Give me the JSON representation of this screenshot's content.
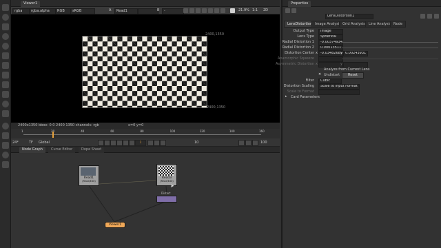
{
  "viewer": {
    "tab_label": "Viewer1",
    "controls": {
      "channels": "rgba",
      "layer": "rgba.alpha",
      "colorspace": "RGB",
      "lut": "sRGB",
      "input_a_label": "A",
      "input_a": "Read1",
      "input_b_label": "B",
      "input_b": "-",
      "zoom": "21.9%",
      "ratio": "1:1",
      "mode": "2D"
    },
    "image_corner_top": "2400,1350",
    "image_corner_bottom": "2400,1350",
    "info_left": "2400x1350  bbox: 0 0 2400 1350 channels: rgb",
    "info_coord": "x=0 y=0",
    "timeline_ticks": [
      "1",
      "20",
      "40",
      "60",
      "80",
      "100",
      "120",
      "140",
      "160"
    ],
    "playback": {
      "fps": "24*",
      "tf": "TF",
      "global": "Global",
      "frame": "1",
      "step": "10",
      "end_frame": "100"
    }
  },
  "node_tabs": [
    "Node Graph",
    "Curve Editor",
    "Dope Sheet"
  ],
  "nodes": {
    "read_left_label": "Read1",
    "read_left_sub": "(Read/Edit)",
    "read_right_label": "Read3",
    "read_right_sub": "(Read/Edit)",
    "distort_label": "Distort",
    "viewer_label": "Viewer1"
  },
  "properties": {
    "panel_title": "Properties",
    "node_name": "LensDistortion1",
    "tabs": [
      "LensDistortion",
      "Image Analysis",
      "Grid Analysis",
      "Line Analysis",
      "Node"
    ],
    "fields": {
      "output_type_label": "Output Type",
      "output_type": "Image",
      "lens_type_label": "Lens Type",
      "lens_type": "Spherical",
      "radial1_label": "Radial Distortion 1",
      "radial1": "-0.00374934",
      "radial2_label": "Radial Distortion 2",
      "radial2": "0.00013511",
      "center_label": "Distortion Center",
      "center_x_label": "x",
      "center_x": "-0.03482689",
      "center_y_label": "y",
      "center_y": "0.00243931",
      "anamorphic_label": "Anamorphic Squeeze",
      "asym_label": "Asymmetric Distortion",
      "asym_x_label": "x",
      "asym_y_label": "y",
      "analyze_label": "Analyze from Current Lens",
      "undistort_label": "Undistort",
      "reset_label": "Reset",
      "filter_label": "Filter",
      "filter": "Cubic",
      "scaling_label": "Distortion Scaling",
      "scaling": "Scale to Input Format",
      "scale_format_label": "Scale to Format",
      "card_params_label": "Card Parameters",
      "slider_ticks": [
        "-0.2",
        "-0.1",
        "0",
        "0.1",
        "0.2",
        "0.3",
        "0.4",
        "0.5",
        "1"
      ]
    }
  },
  "colors": {
    "read_node": "#a0a0a0",
    "distort_node": "#7f6ea8",
    "viewer_node": "#f0a858",
    "accent_orange": "#e8a23b"
  }
}
